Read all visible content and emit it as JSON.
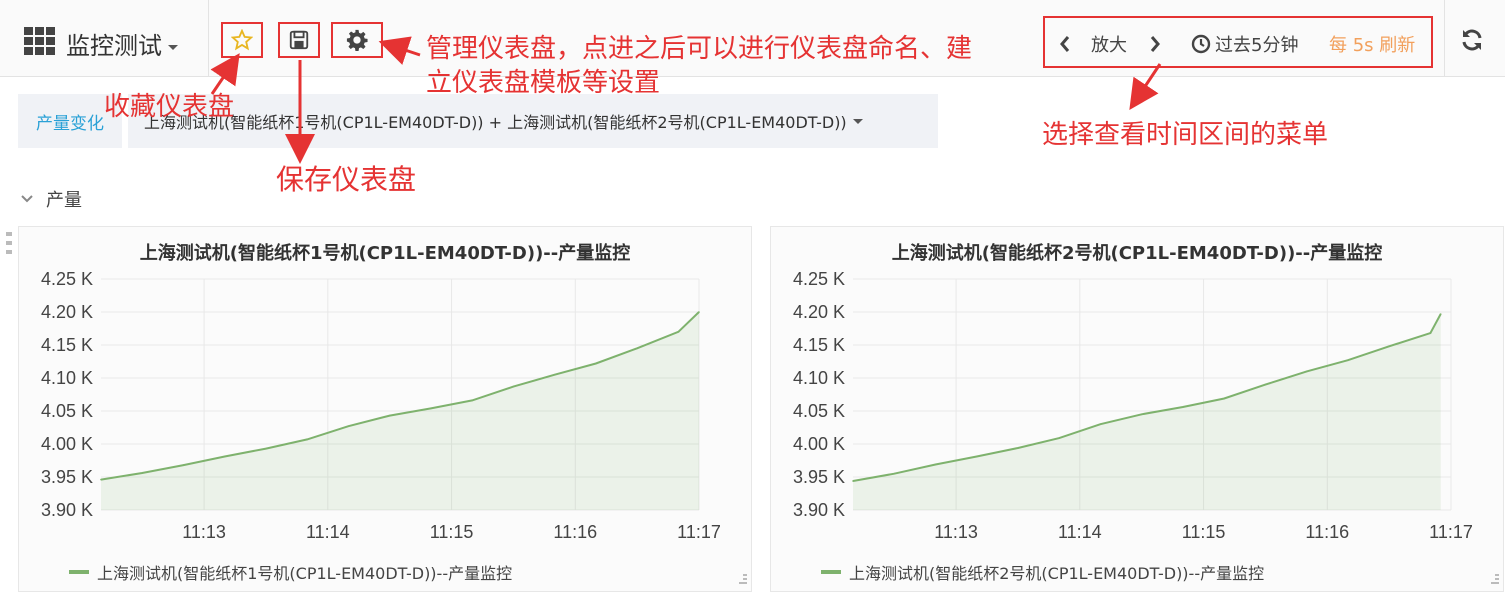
{
  "navbar": {
    "dashboard_title": "监控测试",
    "time_controls": {
      "zoom_label": "放大",
      "range_label": "过去5分钟",
      "refresh_label": "每 5s 刷新"
    }
  },
  "annotations": {
    "star": "收藏仪表盘",
    "save": "保存仪表盘",
    "settings_line1": "管理仪表盘，点进之后可以进行仪表盘命名、建",
    "settings_line2": "立仪表盘模板等设置",
    "time": "选择查看时间区间的菜单"
  },
  "variables": {
    "label": "产量变化",
    "value": "上海测试机(智能纸杯1号机(CP1L-EM40DT-D)) + 上海测试机(智能纸杯2号机(CP1L-EM40DT-D))"
  },
  "row": {
    "title": "产量"
  },
  "colors": {
    "series": "#7eb26d",
    "annotation": "#e53333",
    "accent": "#2aa1d6",
    "refresh": "#f2a05c"
  },
  "chart_data": [
    {
      "type": "area",
      "title": "上海测试机(智能纸杯1号机(CP1L-EM40DT-D))--产量监控",
      "y_ticks": [
        "3.90 K",
        "3.95 K",
        "4.00 K",
        "4.05 K",
        "4.10 K",
        "4.15 K",
        "4.20 K",
        "4.25 K"
      ],
      "ylim": [
        3900,
        4250
      ],
      "x_ticks": [
        "11:13",
        "11:14",
        "11:15",
        "11:16",
        "11:17"
      ],
      "xlim": [
        "11:12:10",
        "11:17:00"
      ],
      "series": [
        {
          "name": "上海测试机(智能纸杯1号机(CP1L-EM40DT-D))--产量监控",
          "x": [
            "11:12:10",
            "11:12:30",
            "11:12:50",
            "11:13:10",
            "11:13:30",
            "11:13:50",
            "11:14:10",
            "11:14:30",
            "11:14:50",
            "11:15:10",
            "11:15:30",
            "11:15:50",
            "11:16:10",
            "11:16:30",
            "11:16:50",
            "11:17:00"
          ],
          "values": [
            3946,
            3956,
            3968,
            3981,
            3993,
            4007,
            4027,
            4043,
            4054,
            4066,
            4087,
            4105,
            4122,
            4145,
            4170,
            4200
          ]
        }
      ]
    },
    {
      "type": "area",
      "title": "上海测试机(智能纸杯2号机(CP1L-EM40DT-D))--产量监控",
      "y_ticks": [
        "3.90 K",
        "3.95 K",
        "4.00 K",
        "4.05 K",
        "4.10 K",
        "4.15 K",
        "4.20 K",
        "4.25 K"
      ],
      "ylim": [
        3900,
        4250
      ],
      "x_ticks": [
        "11:13",
        "11:14",
        "11:15",
        "11:16",
        "11:17"
      ],
      "xlim": [
        "11:12:10",
        "11:17:00"
      ],
      "series": [
        {
          "name": "上海测试机(智能纸杯2号机(CP1L-EM40DT-D))--产量监控",
          "x": [
            "11:12:10",
            "11:12:30",
            "11:12:50",
            "11:13:10",
            "11:13:30",
            "11:13:50",
            "11:14:10",
            "11:14:30",
            "11:14:50",
            "11:15:10",
            "11:15:30",
            "11:15:50",
            "11:16:10",
            "11:16:30",
            "11:16:50",
            "11:16:55"
          ],
          "values": [
            3944,
            3955,
            3969,
            3981,
            3994,
            4009,
            4030,
            4045,
            4056,
            4069,
            4090,
            4110,
            4127,
            4148,
            4168,
            4197
          ]
        }
      ]
    }
  ]
}
